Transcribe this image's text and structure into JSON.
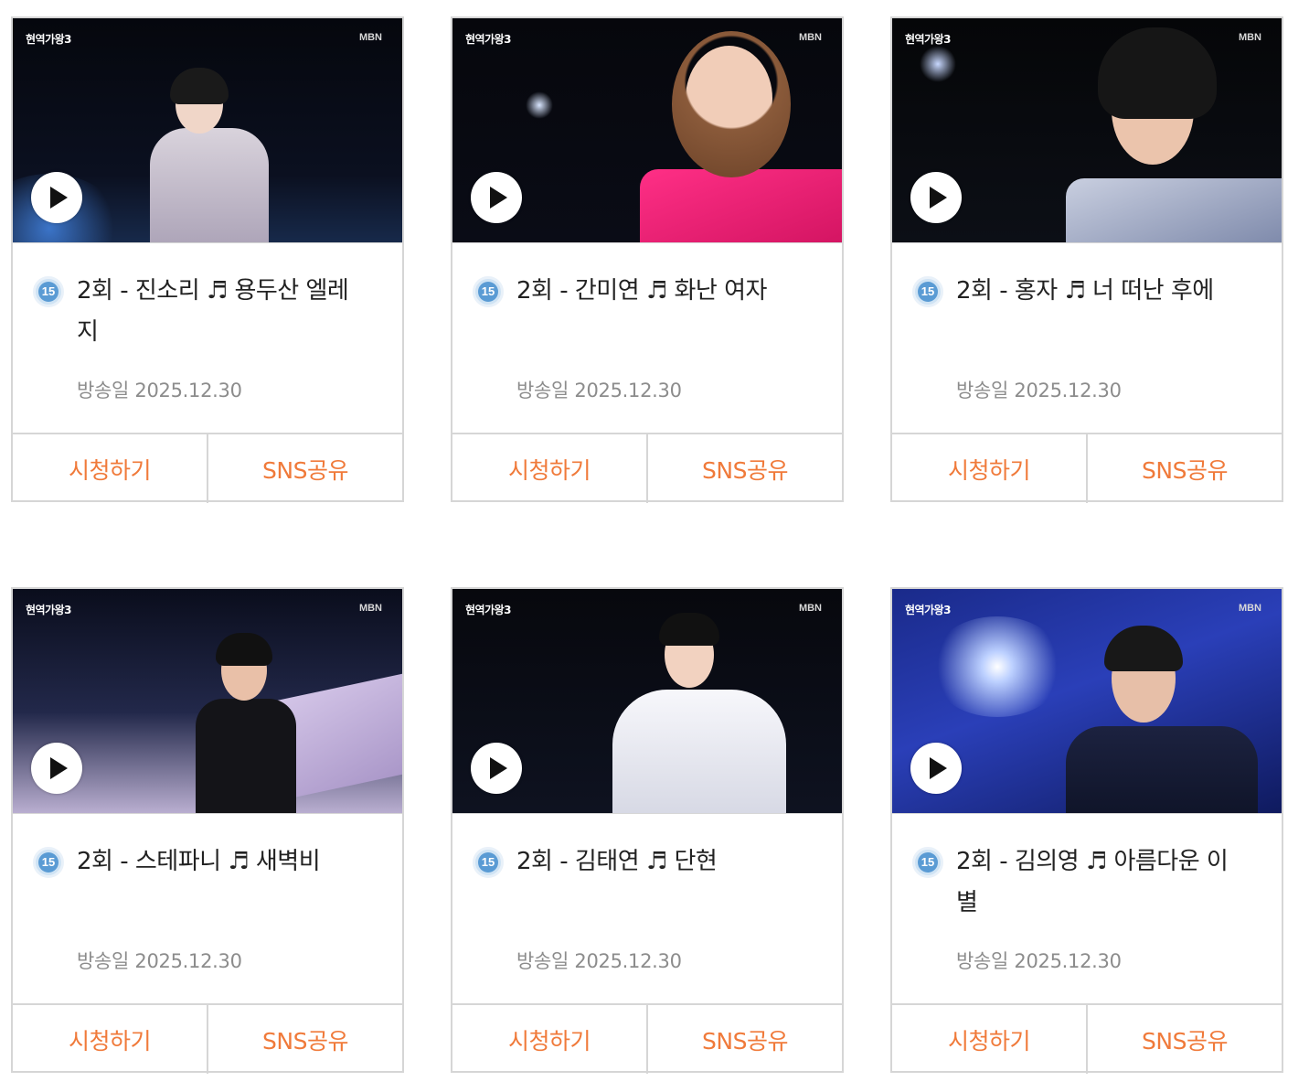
{
  "cards": [
    {
      "title": "2회 - 진소리 ♬ 용두산 엘레지",
      "date": "방송일 2025.12.30",
      "rating": "15",
      "watch_label": "시청하기",
      "share_label": "SNS공유",
      "logo": "현역가왕3",
      "channel": "MBN",
      "play_icon": "play-icon"
    },
    {
      "title": "2회 - 간미연 ♬ 화난 여자",
      "date": "방송일 2025.12.30",
      "rating": "15",
      "watch_label": "시청하기",
      "share_label": "SNS공유",
      "logo": "현역가왕3",
      "channel": "MBN",
      "play_icon": "play-icon"
    },
    {
      "title": "2회 - 홍자 ♬ 너 떠난 후에",
      "date": "방송일 2025.12.30",
      "rating": "15",
      "watch_label": "시청하기",
      "share_label": "SNS공유",
      "logo": "현역가왕3",
      "channel": "MBN",
      "play_icon": "play-icon"
    },
    {
      "title": "2회 - 스테파니 ♬ 새벽비",
      "date": "방송일 2025.12.30",
      "rating": "15",
      "watch_label": "시청하기",
      "share_label": "SNS공유",
      "logo": "현역가왕3",
      "channel": "MBN",
      "play_icon": "play-icon"
    },
    {
      "title": "2회 - 김태연 ♬ 단현",
      "date": "방송일 2025.12.30",
      "rating": "15",
      "watch_label": "시청하기",
      "share_label": "SNS공유",
      "logo": "현역가왕3",
      "channel": "MBN",
      "play_icon": "play-icon"
    },
    {
      "title": "2회 - 김의영 ♬ 아름다운 이별",
      "date": "방송일 2025.12.30",
      "rating": "15",
      "watch_label": "시청하기",
      "share_label": "SNS공유",
      "logo": "현역가왕3",
      "channel": "MBN",
      "play_icon": "play-icon"
    }
  ],
  "colors": {
    "accent": "#f07a3a",
    "border": "#d6d6d6",
    "title": "#222222",
    "date": "#8c8c8c",
    "rating_badge": "#5a9bd4"
  }
}
